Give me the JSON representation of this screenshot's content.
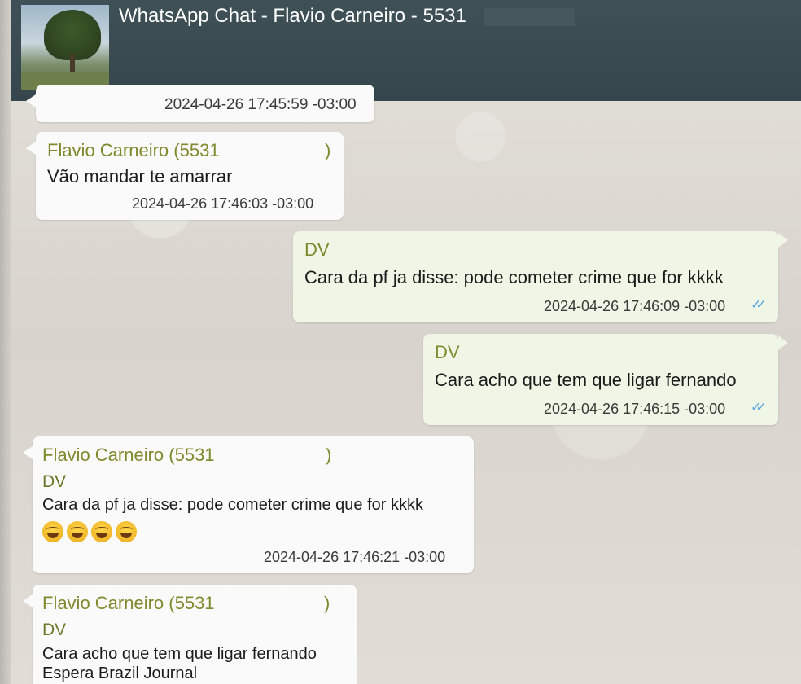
{
  "header": {
    "title": "WhatsApp Chat - Flavio Carneiro - 5531"
  },
  "messages": [
    {
      "direction": "in",
      "timestamp": "2024-04-26 17:45:59 -03:00"
    },
    {
      "direction": "in",
      "sender": "Flavio Carneiro (5531",
      "sender_close": ")",
      "text": "Vão mandar te amarrar",
      "timestamp": "2024-04-26 17:46:03 -03:00"
    },
    {
      "direction": "out",
      "sender": "DV",
      "text": "Cara da pf ja disse: pode cometer crime que for kkkk",
      "timestamp": "2024-04-26 17:46:09 -03:00",
      "status_icon": "double-check-icon"
    },
    {
      "direction": "out",
      "sender": "DV",
      "text": "Cara acho que tem que ligar fernando",
      "timestamp": "2024-04-26 17:46:15 -03:00",
      "status_icon": "double-check-icon"
    },
    {
      "direction": "in",
      "sender": "Flavio Carneiro (5531",
      "sender_close": ")",
      "quoted_sender": "DV",
      "quoted_text": "Cara da pf ja disse: pode cometer crime que for kkkk",
      "emojis": [
        "face-with-tears-of-joy",
        "face-with-tears-of-joy",
        "face-with-tears-of-joy",
        "face-with-tears-of-joy"
      ],
      "timestamp": "2024-04-26 17:46:21 -03:00"
    },
    {
      "direction": "in",
      "sender": "Flavio Carneiro (5531",
      "sender_close": ")",
      "quoted_sender": "DV",
      "quoted_text": "Cara acho que tem que ligar fernando",
      "text": "Espera Brazil Journal"
    }
  ],
  "colors": {
    "header_bg": "#3f5157",
    "incoming_bubble": "#fafafa",
    "outgoing_bubble": "#eff6e6",
    "sender_name": "#7e8a2e",
    "read_ticks": "#5aa6e0"
  }
}
